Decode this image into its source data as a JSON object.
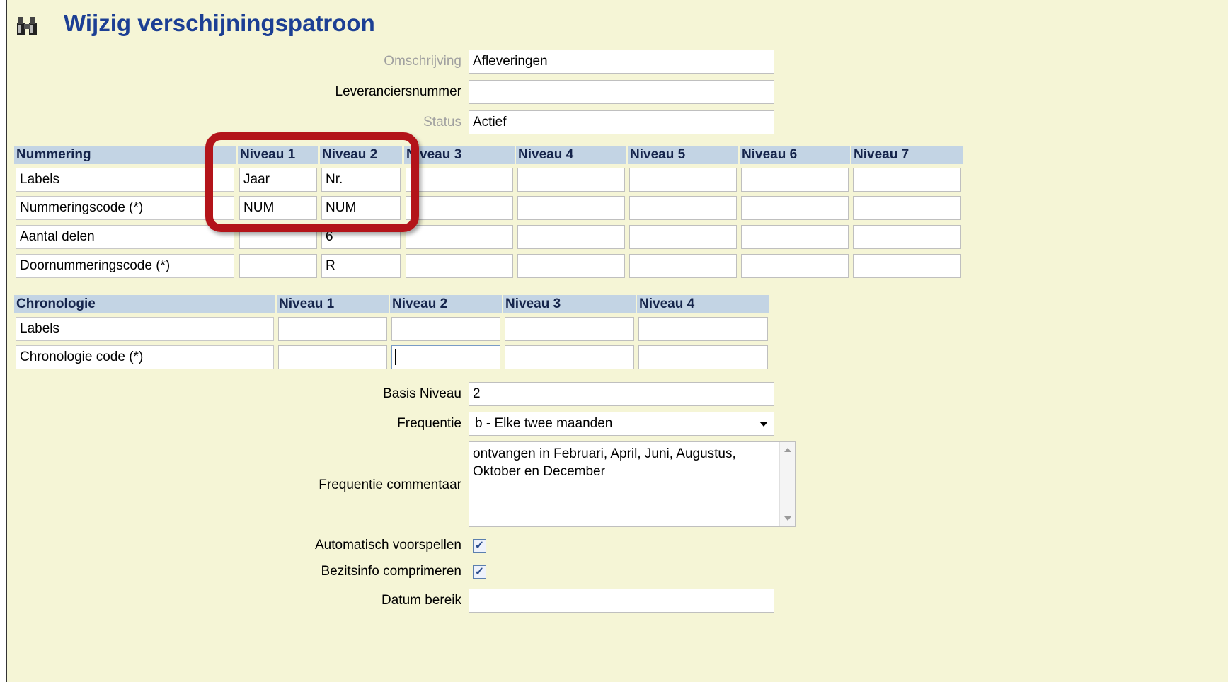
{
  "page": {
    "title": "Wijzig verschijningspatroon",
    "title_icon": "binoculars-icon"
  },
  "form_top": {
    "omschrijving": {
      "label": "Omschrijving",
      "value": "Afleveringen"
    },
    "leveranciersnummer": {
      "label": "Leveranciersnummer",
      "value": ""
    },
    "status": {
      "label": "Status",
      "value": "Actief"
    }
  },
  "nummering": {
    "header": "Nummering",
    "columns": [
      "Niveau 1",
      "Niveau 2",
      "Niveau 3",
      "Niveau 4",
      "Niveau 5",
      "Niveau 6",
      "Niveau 7"
    ],
    "rows": [
      {
        "label": "Labels",
        "values": [
          "Jaar",
          "Nr.",
          "",
          "",
          "",
          "",
          ""
        ]
      },
      {
        "label": "Nummeringscode (*)",
        "values": [
          "NUM",
          "NUM",
          "",
          "",
          "",
          "",
          ""
        ]
      },
      {
        "label": "Aantal delen",
        "values": [
          "",
          "6",
          "",
          "",
          "",
          "",
          ""
        ]
      },
      {
        "label": "Doornummeringscode (*)",
        "values": [
          "",
          "R",
          "",
          "",
          "",
          "",
          ""
        ]
      }
    ]
  },
  "chronologie": {
    "header": "Chronologie",
    "columns": [
      "Niveau 1",
      "Niveau 2",
      "Niveau 3",
      "Niveau 4"
    ],
    "rows": [
      {
        "label": "Labels",
        "values": [
          "",
          "",
          "",
          ""
        ]
      },
      {
        "label": "Chronologie code (*)",
        "values": [
          "",
          "",
          "",
          ""
        ]
      }
    ]
  },
  "form_bottom": {
    "basis_niveau": {
      "label": "Basis Niveau",
      "value": "2"
    },
    "frequentie": {
      "label": "Frequentie",
      "value": "b - Elke twee maanden",
      "icon": "dropdown-arrow-icon"
    },
    "frequentie_commentaar": {
      "label": "Frequentie commentaar",
      "value": "ontvangen in Februari, April, Juni, Augustus, Oktober en December"
    },
    "automatisch_voorspellen": {
      "label": "Automatisch voorspellen",
      "checked": true
    },
    "bezitsinfo_comprimeren": {
      "label": "Bezitsinfo comprimeren",
      "checked": true
    },
    "datum_bereik": {
      "label": "Datum bereik",
      "value": ""
    }
  },
  "colors": {
    "background": "#f5f5d6",
    "header_band": "#c3d4e4",
    "title": "#1c3f94",
    "highlight": "#b3141a"
  }
}
